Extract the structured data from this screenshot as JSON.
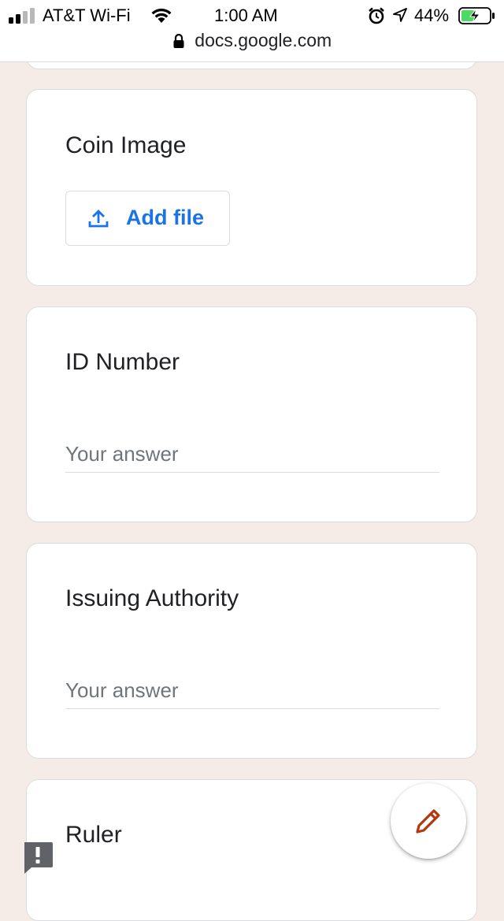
{
  "status_bar": {
    "carrier": "AT&T Wi-Fi",
    "time": "1:00 AM",
    "battery_percent": "44%",
    "battery_color": "#4cd964"
  },
  "browser": {
    "url": "docs.google.com"
  },
  "form": {
    "accent_color": "#1a73e8",
    "background_color": "#f5ebe7",
    "questions": [
      {
        "title": "Coin Image",
        "type": "file",
        "button_label": "Add file"
      },
      {
        "title": "ID Number",
        "type": "short-answer",
        "placeholder": "Your answer"
      },
      {
        "title": "Issuing Authority",
        "type": "short-answer",
        "placeholder": "Your answer"
      },
      {
        "title": "Ruler",
        "type": "short-answer"
      }
    ]
  },
  "icons": {
    "signal": "signal-bars-icon",
    "wifi": "wifi-icon",
    "alarm": "alarm-clock-icon",
    "location": "location-arrow-icon",
    "battery": "battery-charging-icon",
    "lock": "lock-icon",
    "upload": "upload-icon",
    "fab": "pencil-icon",
    "feedback": "report-issue-icon"
  },
  "fab_color": "#b5360f"
}
